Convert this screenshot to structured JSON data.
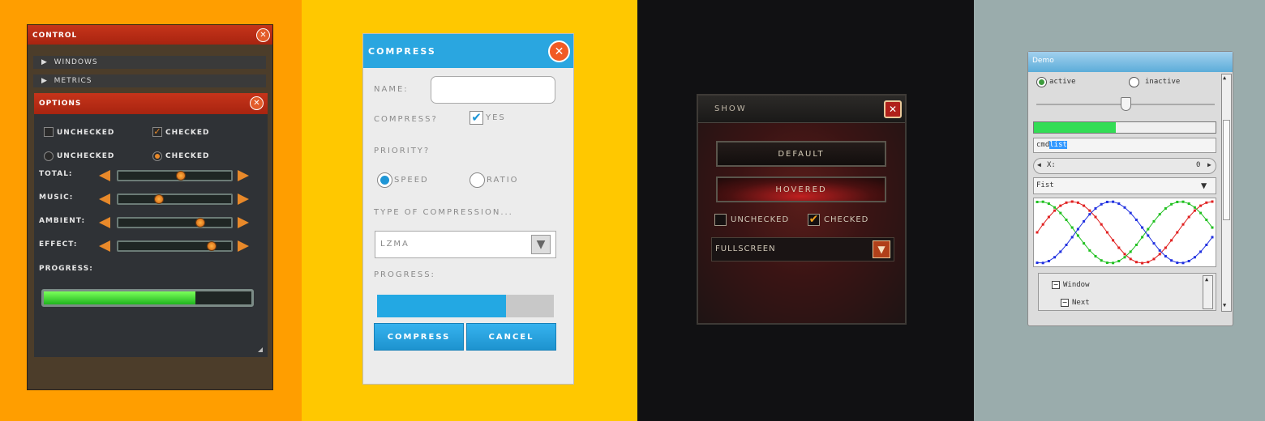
{
  "colors": {
    "panel1_bg": "#ff9e00",
    "panel2_bg": "#ffc800",
    "panel3_bg": "#111113",
    "panel4_bg": "#9aacac",
    "accent_red": "#b8301a",
    "accent_blue": "#2aa6e0",
    "progress_green": "#33dd33",
    "progress_blue": "#23a8e3"
  },
  "control_panel": {
    "title": "CONTROL",
    "tree_items": [
      {
        "label": "WINDOWS"
      },
      {
        "label": "METRICS"
      }
    ],
    "options": {
      "title": "OPTIONS",
      "checkbox_unchecked": "UNCHECKED",
      "checkbox_checked": "CHECKED",
      "radio_unchecked": "UNCHECKED",
      "radio_checked": "CHECKED",
      "sliders": [
        {
          "label": "TOTAL:",
          "value": 0.56
        },
        {
          "label": "MUSIC:",
          "value": 0.35
        },
        {
          "label": "AMBIENT:",
          "value": 0.75
        },
        {
          "label": "EFFECT:",
          "value": 0.86
        }
      ],
      "progress_label": "PROGRESS:",
      "progress_value": 0.73
    }
  },
  "compress_panel": {
    "title": "COMPRESS",
    "name_label": "NAME:",
    "name_value": "",
    "compress_label": "COMPRESS?",
    "compress_checkbox_label": "YES",
    "priority_label": "PRIORITY?",
    "radio_speed": "SPEED",
    "radio_ratio": "RATIO",
    "type_label": "TYPE OF COMPRESSION...",
    "type_value": "LZMA",
    "progress_label": "PROGRESS:",
    "progress_value": 0.73,
    "compress_button": "COMPRESS",
    "cancel_button": "CANCEL"
  },
  "show_panel": {
    "title": "SHOW",
    "default_button": "DEFAULT",
    "hovered_button": "HOVERED",
    "checkbox_unchecked": "UNCHECKED",
    "checkbox_checked": "CHECKED",
    "dropdown_value": "FULLSCREEN"
  },
  "demo_panel": {
    "title": "Demo",
    "radio_active": "active",
    "radio_inactive": "inactive",
    "slider_value": 0.5,
    "progress_value": 0.45,
    "edit_prefix": "cmd",
    "edit_selected": "list",
    "property_label": "X:",
    "property_value": "0",
    "combo_value": "Fist",
    "tree_items": [
      {
        "label": "Window"
      },
      {
        "label": "Next"
      }
    ]
  }
}
